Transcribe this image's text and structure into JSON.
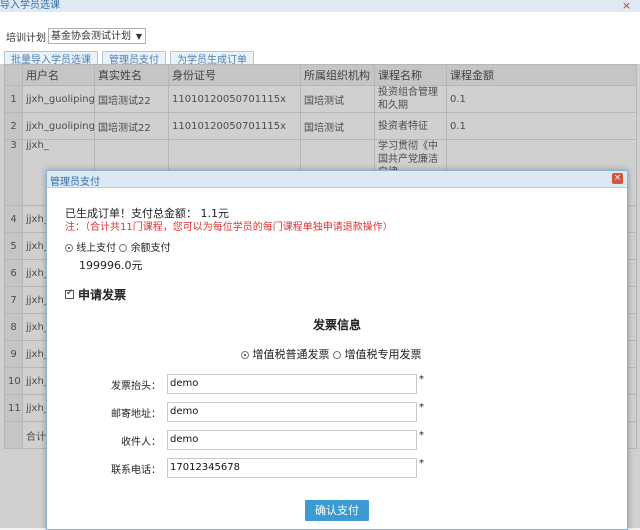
{
  "outer_window": {
    "title": "导入学员选课",
    "close_glyph": "×"
  },
  "filter": {
    "label": "培训计划",
    "selected": "基金协会测试计划",
    "arrow": "▼"
  },
  "toolbar": {
    "batch_import_label": "批量导入学员选课",
    "admin_pay_label": "管理员支付",
    "generate_order_label": "为学员生成订单"
  },
  "table": {
    "columns": [
      "",
      "用户名",
      "真实姓名",
      "身份证号",
      "所属组织机构",
      "课程名称",
      "课程金额"
    ],
    "rows": [
      [
        "1",
        "jjxh_guoliping22",
        "国培测试22",
        "11010120050701115x",
        "国培测试",
        "投资组合管理和久期",
        "0.1"
      ],
      [
        "2",
        "jjxh_guoliping22",
        "国培测试22",
        "11010120050701115x",
        "国培测试",
        "投资者特征",
        "0.1"
      ],
      [
        "3",
        "jjxh_",
        "",
        "",
        "",
        "学习贯彻《中国共产党廉洁自律",
        ""
      ],
      [
        "4",
        "jjxh_",
        "",
        "",
        "",
        "",
        ""
      ],
      [
        "5",
        "jjxh_",
        "",
        "",
        "",
        "",
        ""
      ],
      [
        "6",
        "jjxh_",
        "",
        "",
        "",
        "",
        ""
      ],
      [
        "7",
        "jjxh_",
        "",
        "",
        "",
        "",
        ""
      ],
      [
        "8",
        "jjxh_",
        "",
        "",
        "",
        "",
        ""
      ],
      [
        "9",
        "jjxh_",
        "",
        "",
        "",
        "",
        ""
      ],
      [
        "10",
        "jjxh_",
        "",
        "",
        "",
        "",
        ""
      ],
      [
        "11",
        "jjxh_",
        "",
        "",
        "",
        "",
        ""
      ],
      [
        "",
        "合计",
        "",
        "",
        "",
        "",
        ""
      ]
    ]
  },
  "modal": {
    "title": "管理员支付",
    "close_glyph": "×",
    "order_summary": "已生成订单！支付总金额： 1.1元",
    "note": "注：（合计共11门课程，您可以为每位学员的每门课程单独申请退款操作）",
    "pay_online_label": "线上支付",
    "pay_balance_label": "余额支付",
    "balance_amount": "199996.0元",
    "apply_invoice_label": "申请发票",
    "invoice_info_title": "发票信息",
    "invoice_normal_label": "增值税普通发票",
    "invoice_special_label": "增值税专用发票",
    "fields": {
      "title_label": "发票抬头：",
      "title_value": "demo",
      "address_label": "邮寄地址：",
      "address_value": "demo",
      "receiver_label": "收件人：",
      "receiver_value": "demo",
      "phone_label": "联系电话：",
      "phone_value": "17012345678",
      "required_mark": "*"
    },
    "confirm_label": "确认支付"
  }
}
